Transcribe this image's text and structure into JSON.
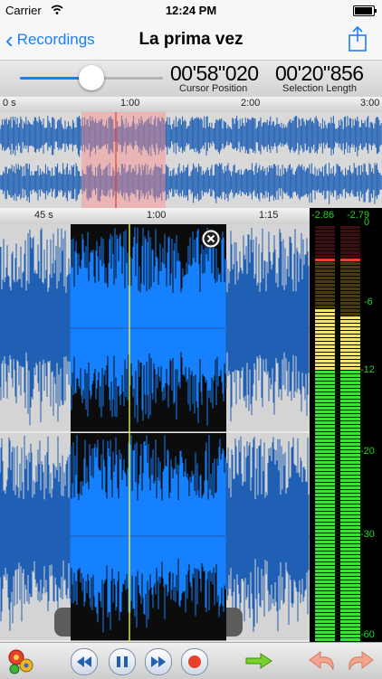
{
  "status_bar": {
    "carrier": "Carrier",
    "time": "12:24 PM"
  },
  "nav": {
    "back_label": "Recordings",
    "title": "La prima vez"
  },
  "cursor": {
    "position_value": "00'58\"020",
    "position_label": "Cursor Position",
    "selection_value": "00'20\"856",
    "selection_label": "Selection Length",
    "slider_fraction": 0.5
  },
  "overview_ruler": {
    "ticks": [
      "0 s",
      "1:00",
      "2:00",
      "3:00"
    ]
  },
  "main_ruler": {
    "ticks": [
      "45 s",
      "1:00",
      "1:15"
    ]
  },
  "meter": {
    "left_peak": "-2.86",
    "right_peak": "-2.79",
    "scale": [
      "0",
      "-6",
      "-12",
      "-20",
      "-30",
      "-60"
    ]
  },
  "toolbar": {
    "items": [
      "settings-icon",
      "rewind-icon",
      "pause-icon",
      "forward-icon",
      "record-icon",
      "export-arrow-icon",
      "undo-icon",
      "redo-icon"
    ]
  },
  "colors": {
    "accent": "#1a7dff",
    "wave": "#1f5fb4",
    "wave_selected": "#1681ff",
    "record": "#e8402a"
  }
}
